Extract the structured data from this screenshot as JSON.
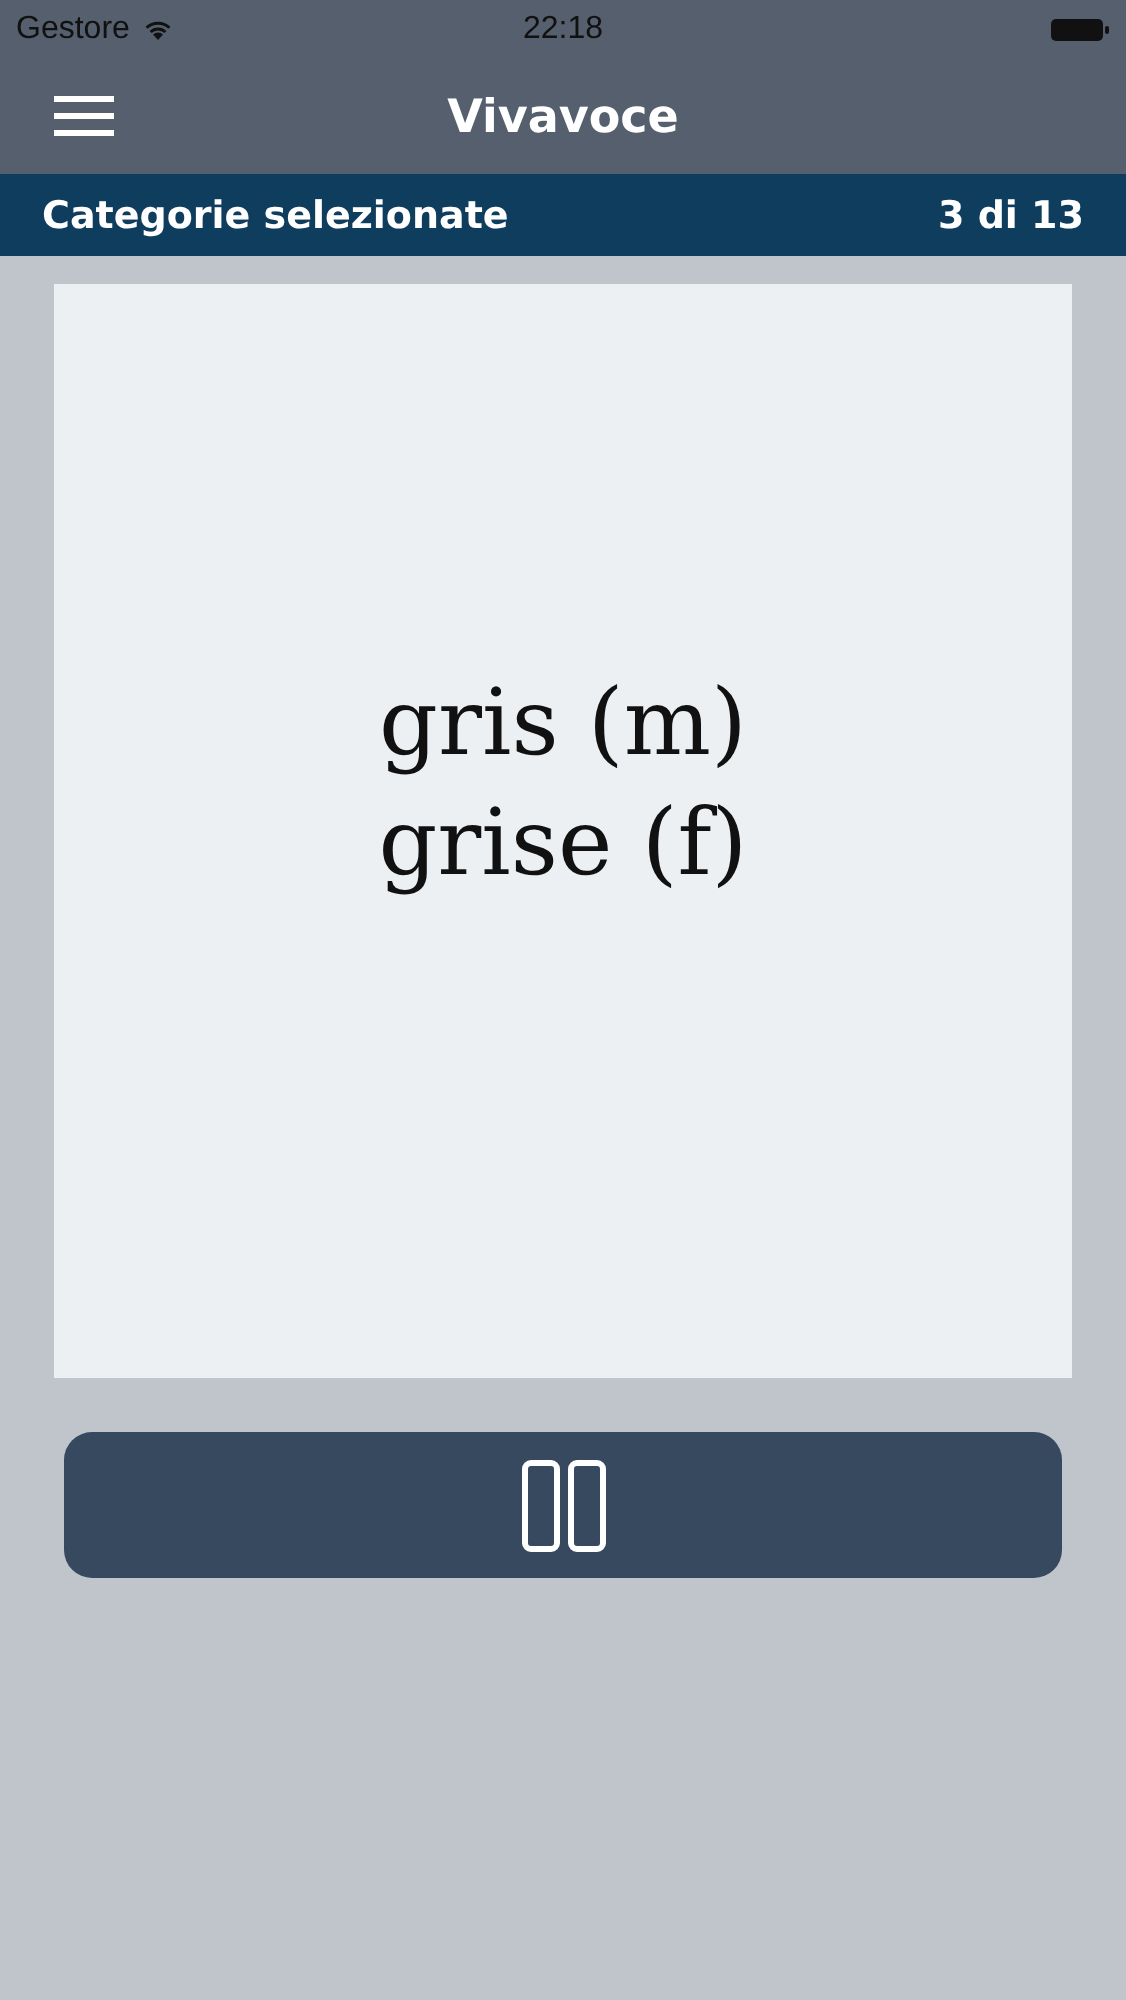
{
  "status_bar": {
    "carrier": "Gestore",
    "time": "22:18"
  },
  "nav_bar": {
    "title": "Vivavoce"
  },
  "category_bar": {
    "label": "Categorie selezionate",
    "count": "3 di 13"
  },
  "card": {
    "lines": [
      "gris (m)",
      "grise (f)"
    ]
  },
  "pause_button": {
    "playing": true
  }
}
